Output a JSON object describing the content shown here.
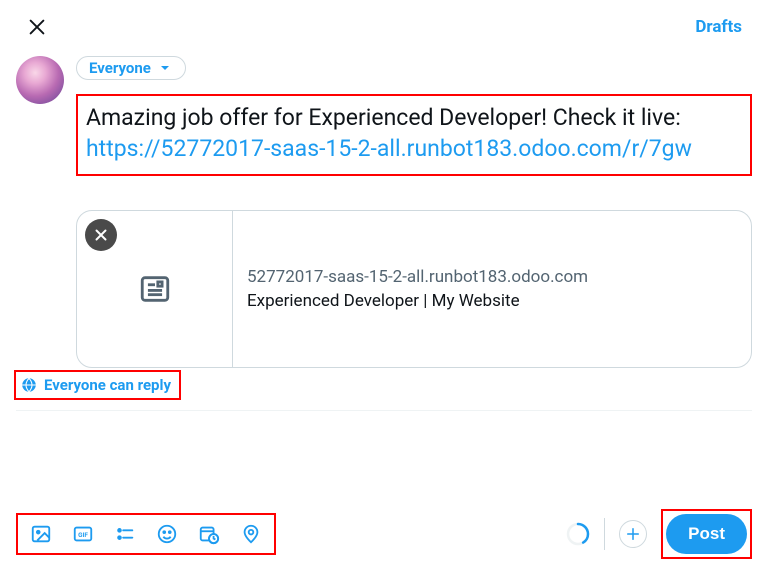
{
  "header": {
    "drafts_label": "Drafts"
  },
  "composer": {
    "audience_label": "Everyone",
    "text_plain": "Amazing job offer for Experienced Developer! Check it live: ",
    "text_link": "https://52772017-saas-15-2-all.runbot183.odoo.com/r/7gw"
  },
  "link_preview": {
    "domain": "52772017-saas-15-2-all.runbot183.odoo.com",
    "title": "Experienced Developer | My Website"
  },
  "reply_settings": {
    "label": "Everyone can reply"
  },
  "post_button": {
    "label": "Post"
  },
  "colors": {
    "accent": "#1d9bf0",
    "highlight_border": "#ff0000"
  }
}
